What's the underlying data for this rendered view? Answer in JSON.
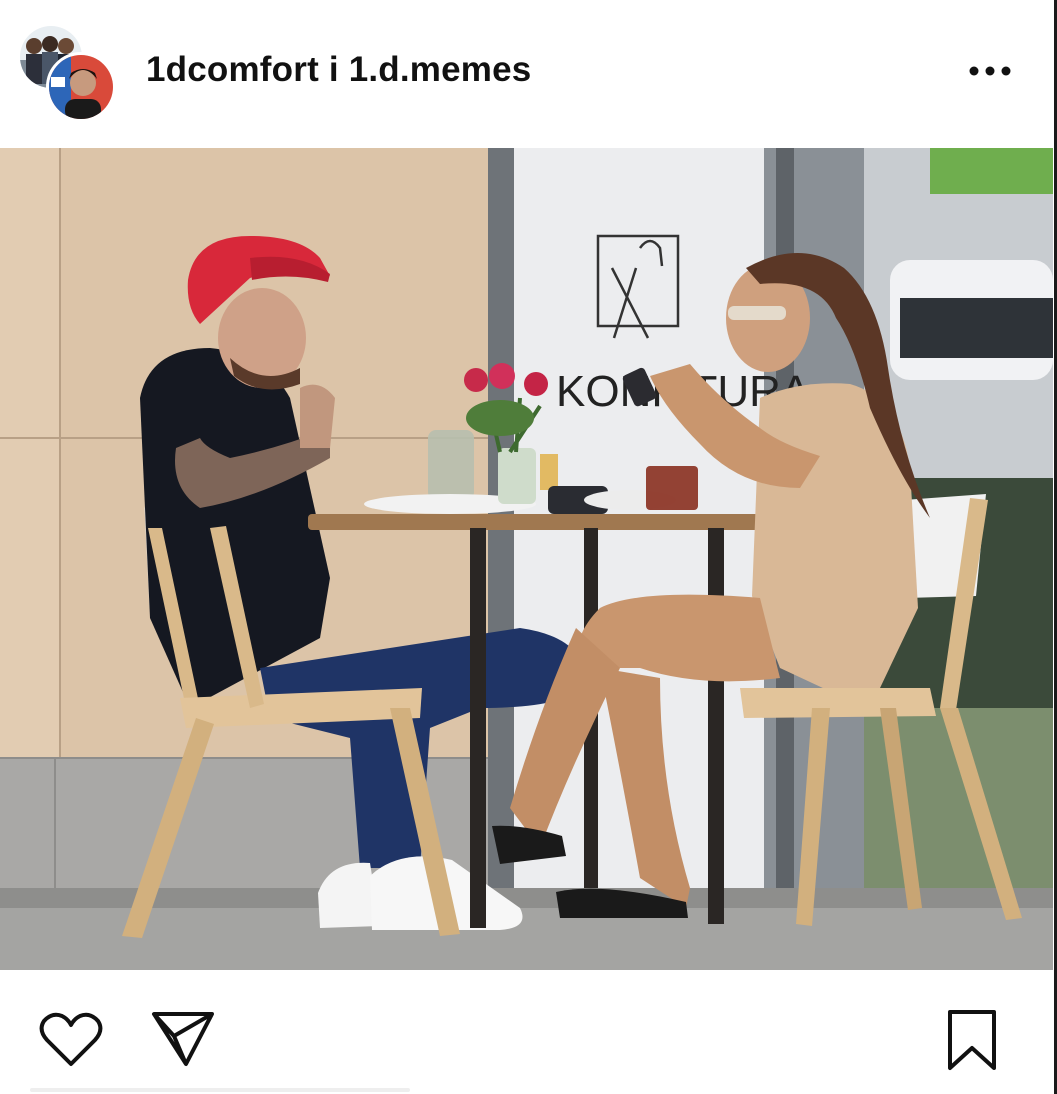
{
  "post": {
    "username": "1dcomfort i 1.d.memes",
    "more_icon": "more-horizontal-icon"
  },
  "photo": {
    "sign_text": "KONFITURA",
    "icon": "fork-knife-icon"
  },
  "actions": {
    "like_icon": "heart-icon",
    "share_icon": "send-icon",
    "save_icon": "bookmark-icon"
  },
  "colors": {
    "cap": "#d8283a",
    "wall": "#dcc4a8",
    "chair": "#d9b98a",
    "dress": "#d9b896",
    "jeans": "#1f3466"
  }
}
